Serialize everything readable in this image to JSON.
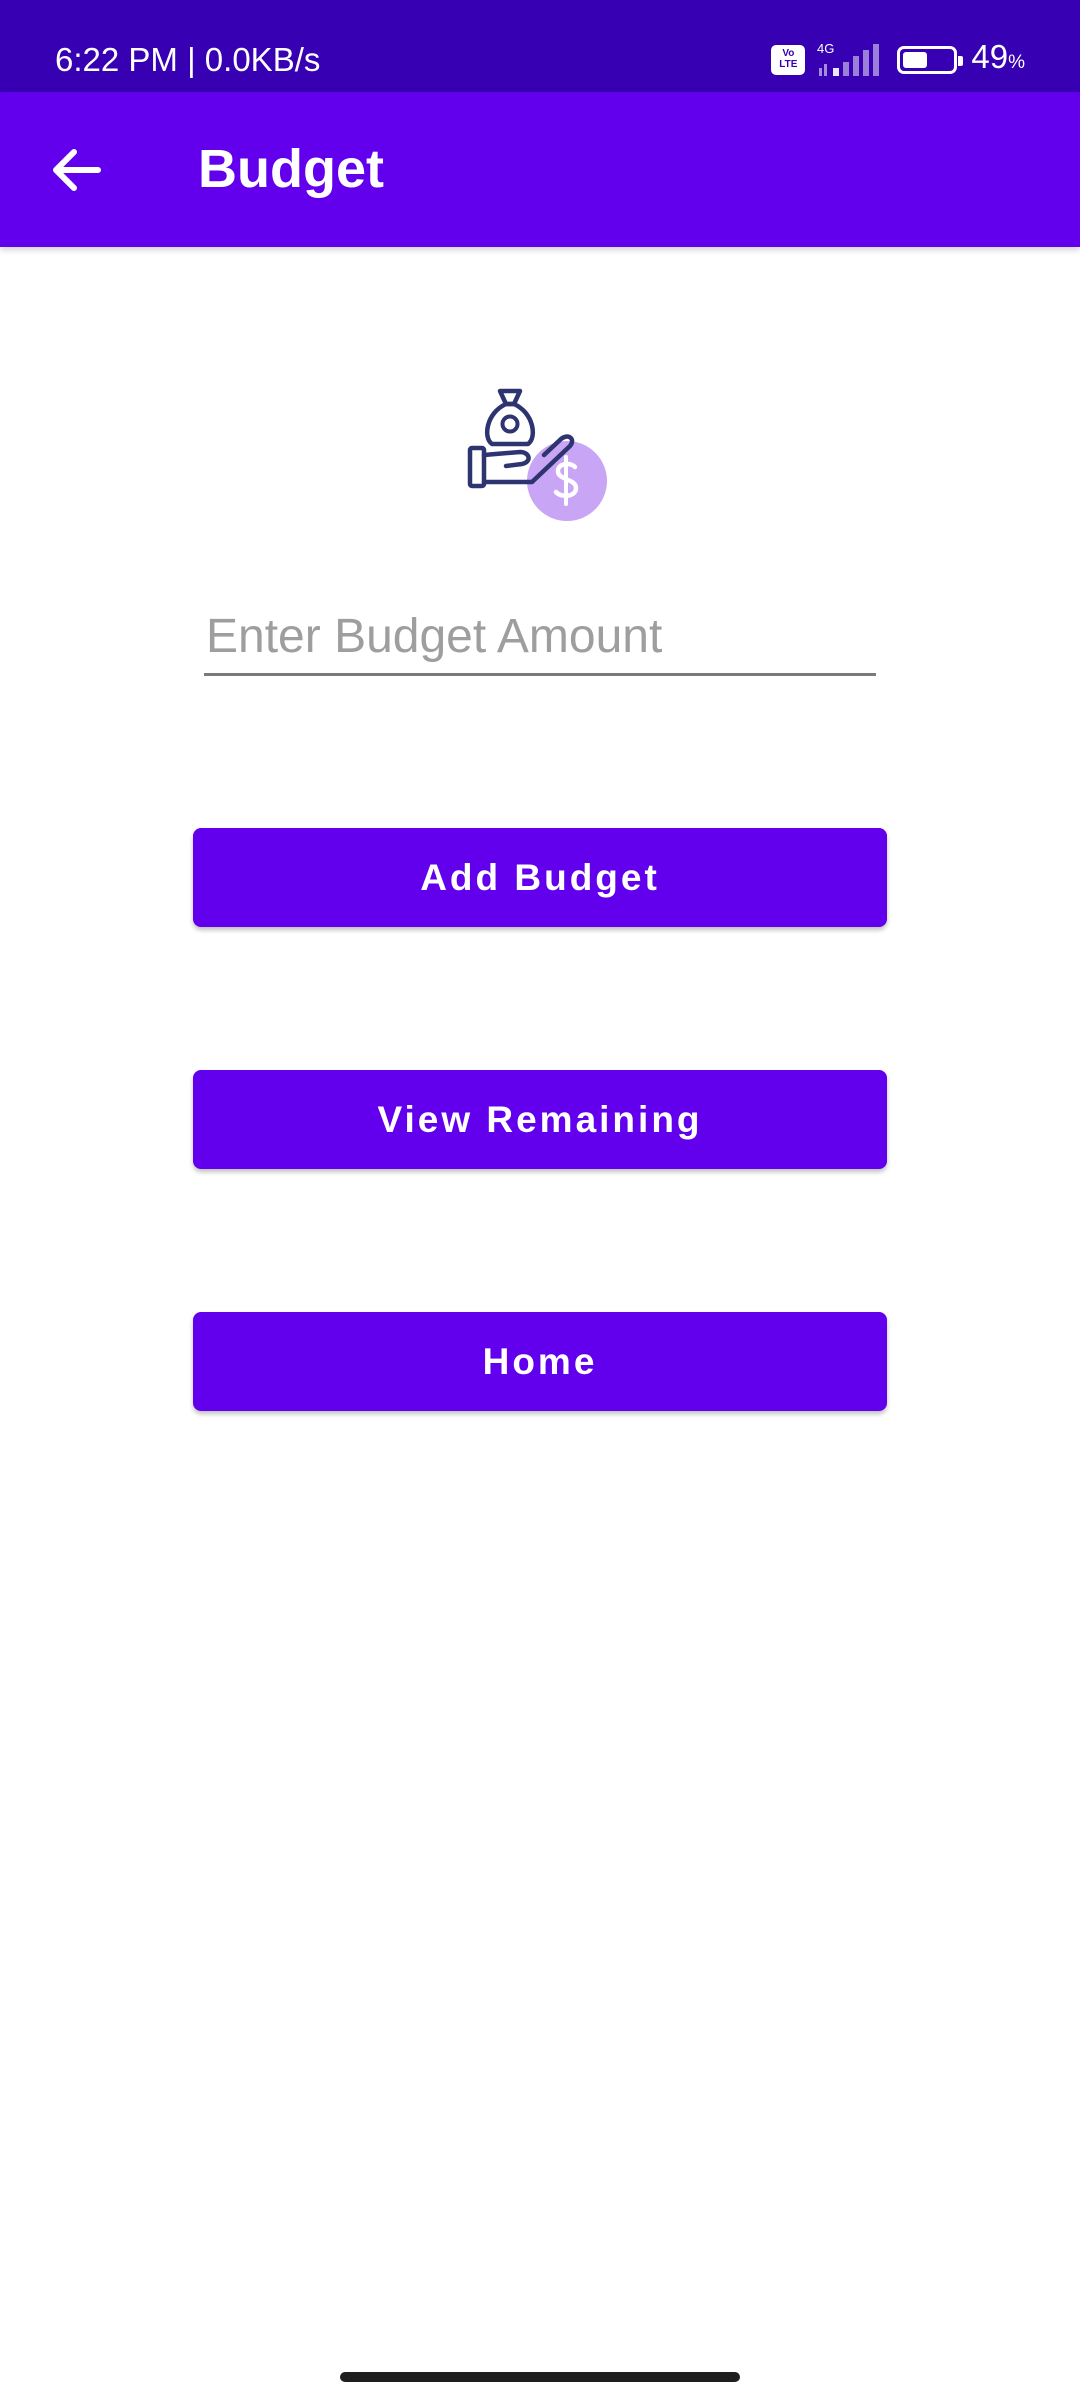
{
  "status_bar": {
    "time_text": "6:22 PM | 0.0KB/s",
    "volte_line1": "Vo",
    "volte_line2": "LTE",
    "network_label": "4G",
    "battery_level": 49,
    "battery_number": "49",
    "battery_symbol": "%"
  },
  "app_bar": {
    "back_icon": "arrow-back-icon",
    "title": "Budget"
  },
  "illustration": {
    "icon": "hand-money-bag-dollar-icon",
    "accent_color": "#c9a5f5"
  },
  "budget_input": {
    "value": "",
    "placeholder": "Enter Budget Amount"
  },
  "buttons": {
    "add_budget": "Add Budget",
    "view_remaining": "View Remaining",
    "home": "Home"
  },
  "colors": {
    "status_bar": "#3700b3",
    "primary": "#6200ee",
    "background": "#ffffff",
    "on_primary": "#ffffff"
  }
}
